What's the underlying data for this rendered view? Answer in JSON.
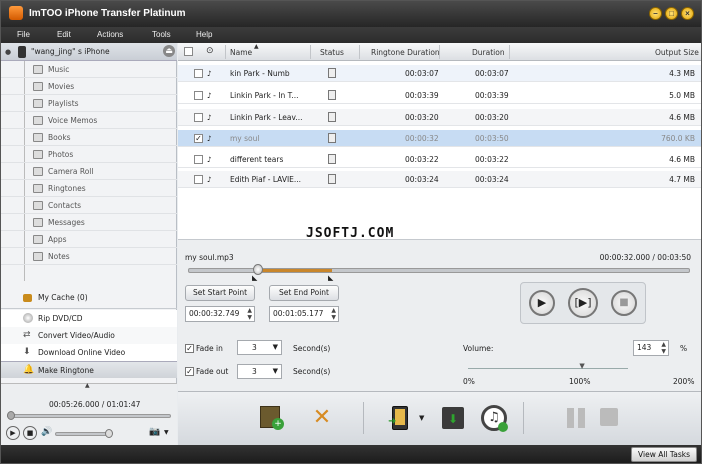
{
  "window": {
    "title": "ImTOO iPhone Transfer Platinum"
  },
  "menu": [
    "File",
    "Edit",
    "Actions",
    "Tools",
    "Help"
  ],
  "device": {
    "name": "\"wang_jing\" s iPhone"
  },
  "library": [
    "Music",
    "Movies",
    "Playlists",
    "Voice Memos",
    "Books",
    "Photos",
    "Camera Roll",
    "Ringtones",
    "Contacts",
    "Messages",
    "Apps",
    "Notes"
  ],
  "my_cache": "My Cache (0)",
  "tasks": [
    "Rip DVD/CD",
    "Convert Video/Audio",
    "Download Online Video",
    "Make Ringtone"
  ],
  "player": {
    "time": "00:05:26.000 / 01:01:47"
  },
  "table": {
    "columns": {
      "name": "Name",
      "status": "Status",
      "ringtone_duration": "Ringtone Duration",
      "duration": "Duration",
      "output_size": "Output Size"
    },
    "rows": [
      {
        "name": "kin Park - Numb",
        "ringtone_duration": "00:03:07",
        "duration": "00:03:07",
        "output_size": "4.3 MB",
        "checked": false
      },
      {
        "name": "Linkin Park - In T...",
        "ringtone_duration": "00:03:39",
        "duration": "00:03:39",
        "output_size": "5.0 MB",
        "checked": false
      },
      {
        "name": "Linkin Park - Leav...",
        "ringtone_duration": "00:03:20",
        "duration": "00:03:20",
        "output_size": "4.6 MB",
        "checked": false
      },
      {
        "name": "my soul",
        "ringtone_duration": "00:00:32",
        "duration": "00:03:50",
        "output_size": "760.0 KB",
        "checked": true
      },
      {
        "name": "different tears",
        "ringtone_duration": "00:03:22",
        "duration": "00:03:22",
        "output_size": "4.6 MB",
        "checked": false
      },
      {
        "name": "Edith Piaf - LAVIE...",
        "ringtone_duration": "00:03:24",
        "duration": "00:03:24",
        "output_size": "4.7 MB",
        "checked": false
      }
    ]
  },
  "watermark": "JSOFTJ.COM",
  "editor": {
    "file": "my soul.mp3",
    "time": "00:00:32.000 / 00:03:50",
    "set_start": "Set Start Point",
    "set_end": "Set End Point",
    "start_value": "00:00:32.749",
    "end_value": "00:01:05.177",
    "fade_in_label": "Fade in",
    "fade_in_value": "3",
    "fade_out_label": "Fade out",
    "fade_out_value": "3",
    "seconds": "Second(s)",
    "volume_label": "Volume:",
    "volume_value": "143",
    "percent": "%",
    "vol_min": "0%",
    "vol_mid": "100%",
    "vol_max": "200%",
    "position_fraction": 0.14,
    "volume_fraction": 0.715
  },
  "view_all_tasks": "View All Tasks"
}
